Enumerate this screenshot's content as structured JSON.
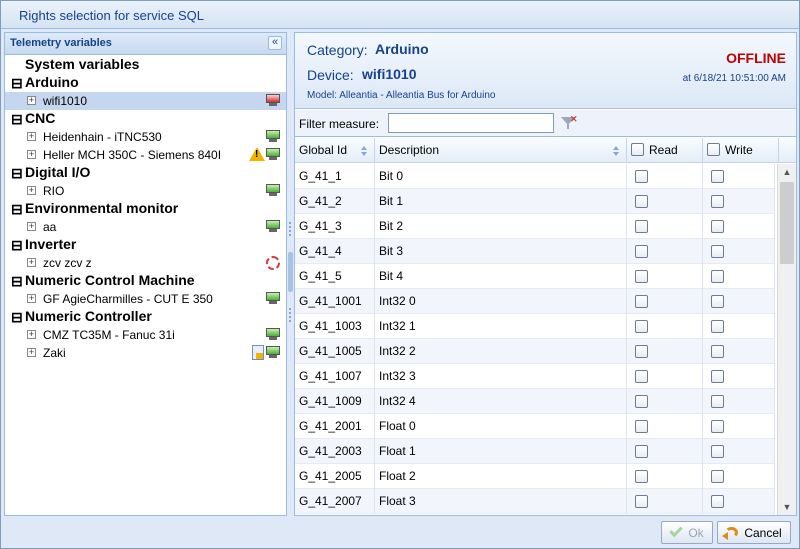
{
  "window": {
    "title": "Rights selection for service SQL"
  },
  "left_panel": {
    "title": "Telemetry variables",
    "tree": [
      {
        "type": "sys",
        "label": "System variables"
      },
      {
        "type": "cat",
        "label": "Arduino"
      },
      {
        "type": "dev",
        "label": "wifi1010",
        "selected": true,
        "status_icon": "pc-offline-icon"
      },
      {
        "type": "cat",
        "label": "CNC"
      },
      {
        "type": "dev",
        "label": "Heidenhain - iTNC530",
        "status_icon": "pc-online-icon"
      },
      {
        "type": "dev",
        "label": "Heller MCH 350C - Siemens 840I",
        "status_icon": "pc-online-icon",
        "extra_icon": "warning-icon"
      },
      {
        "type": "cat",
        "label": "Digital I/O"
      },
      {
        "type": "dev",
        "label": "RIO",
        "status_icon": "pc-online-icon"
      },
      {
        "type": "cat",
        "label": "Environmental monitor"
      },
      {
        "type": "dev",
        "label": "aa",
        "status_icon": "pc-online-icon"
      },
      {
        "type": "cat",
        "label": "Inverter"
      },
      {
        "type": "dev",
        "label": "zcv zcv z",
        "status_icon": "link-broken-icon"
      },
      {
        "type": "cat",
        "label": "Numeric Control Machine"
      },
      {
        "type": "dev",
        "label": "GF AgieCharmilles - CUT E 350",
        "status_icon": "pc-online-icon"
      },
      {
        "type": "cat",
        "label": "Numeric Controller"
      },
      {
        "type": "dev",
        "label": "CMZ TC35M - Fanuc 31i",
        "status_icon": "pc-online-icon"
      },
      {
        "type": "dev",
        "label": "Zaki",
        "status_icon": "pc-online-icon",
        "extra_icon": "document-alert-icon"
      }
    ]
  },
  "info": {
    "category_label": "Category:",
    "category_value": "Arduino",
    "device_label": "Device:",
    "device_value": "wifi1010",
    "model": "Model: Alleantia - Alleantia Bus for Arduino",
    "status": "OFFLINE",
    "timestamp": "at 6/18/21 10:51:00 AM"
  },
  "filter": {
    "label": "Filter measure:",
    "value": "",
    "placeholder": ""
  },
  "grid": {
    "columns": {
      "id": "Global Id",
      "desc": "Description",
      "read": "Read",
      "write": "Write"
    },
    "rows": [
      {
        "id": "G_41_1",
        "desc": "Bit 0"
      },
      {
        "id": "G_41_2",
        "desc": "Bit 1"
      },
      {
        "id": "G_41_3",
        "desc": "Bit 2"
      },
      {
        "id": "G_41_4",
        "desc": "Bit 3"
      },
      {
        "id": "G_41_5",
        "desc": "Bit 4"
      },
      {
        "id": "G_41_1001",
        "desc": "Int32 0"
      },
      {
        "id": "G_41_1003",
        "desc": "Int32 1"
      },
      {
        "id": "G_41_1005",
        "desc": "Int32 2"
      },
      {
        "id": "G_41_1007",
        "desc": "Int32 3"
      },
      {
        "id": "G_41_1009",
        "desc": "Int32 4"
      },
      {
        "id": "G_41_2001",
        "desc": "Float 0"
      },
      {
        "id": "G_41_2003",
        "desc": "Float 1"
      },
      {
        "id": "G_41_2005",
        "desc": "Float 2"
      },
      {
        "id": "G_41_2007",
        "desc": "Float 3"
      }
    ]
  },
  "footer": {
    "ok_label": "Ok",
    "cancel_label": "Cancel"
  },
  "colors": {
    "accent": "#15428b",
    "offline": "#c00000",
    "border": "#99bbe8"
  }
}
